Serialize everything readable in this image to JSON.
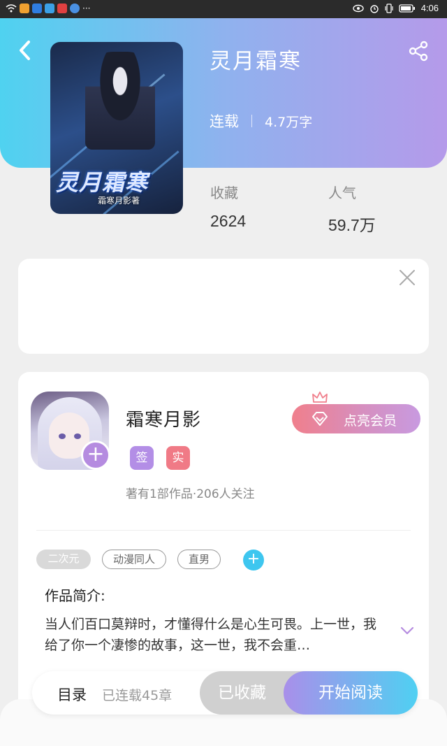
{
  "status_bar": {
    "time": "4:06",
    "dots": "···"
  },
  "book": {
    "title": "灵月霜寒",
    "status": "连载",
    "word_count": "4.7万字",
    "cover_title_art": "灵月霜寒",
    "cover_author_art": "霜寒月影著"
  },
  "stats": {
    "favorites_label": "收藏",
    "favorites_value": "2624",
    "popularity_label": "人气",
    "popularity_value": "59.7万"
  },
  "author": {
    "name": "霜寒月影",
    "badge_signed": "签",
    "badge_verified": "实",
    "meta": "著有1部作品·206人关注",
    "vip_button": "点亮会员"
  },
  "tags": [
    "二次元",
    "动漫同人",
    "直男"
  ],
  "intro": {
    "heading": "作品简介:",
    "text": "当人们百口莫辩时，才懂得什么是心生可畏。上一世，我给了你一个凄惨的故事，这一世，我不会重…"
  },
  "bottom_bar": {
    "toc": "目录",
    "chapters": "已连载45章",
    "collected": "已收藏",
    "start_reading": "开始阅读"
  },
  "colors": {
    "header_start": "#4fd2f0",
    "header_end": "#b59aea",
    "accent_purple": "#b58be0",
    "accent_pink": "#f07a86",
    "accent_cyan": "#3ec6ef"
  }
}
